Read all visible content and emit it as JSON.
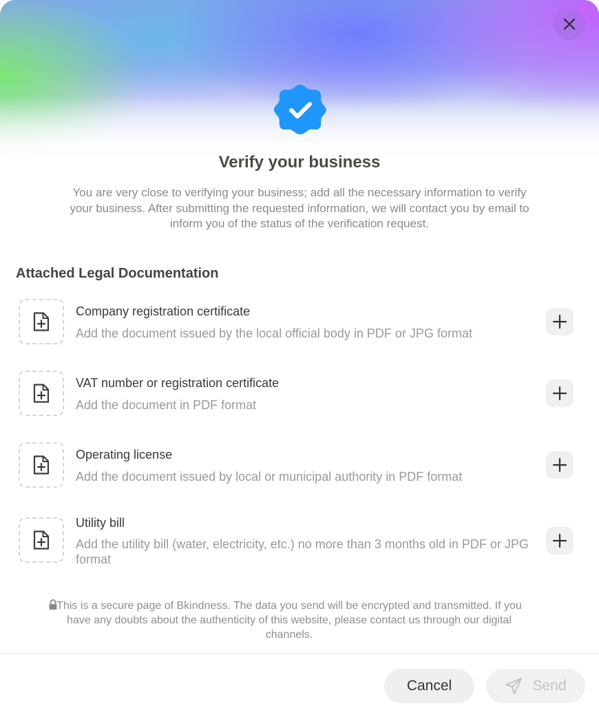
{
  "modal": {
    "title": "Verify your business",
    "description": "You are very close to verifying your business; add all the necessary information to verify your business. After submitting the requested information, we will contact you by email to inform you of the status of the verification request.",
    "close_icon": "close-icon",
    "badge_icon": "verified-badge-icon",
    "badge_color": "#1e96fa"
  },
  "documents": {
    "section_title": "Attached Legal Documentation",
    "items": [
      {
        "title": "Company registration certificate",
        "description": "Add the document issued by the local official body in PDF or JPG format",
        "icon": "file-plus-icon",
        "action_icon": "plus-icon"
      },
      {
        "title": "VAT number or registration certificate",
        "description": "Add the document in PDF format",
        "icon": "file-plus-icon",
        "action_icon": "plus-icon"
      },
      {
        "title": "Operating license",
        "description": "Add the document issued by local or municipal authority in PDF format",
        "icon": "file-plus-icon",
        "action_icon": "plus-icon"
      },
      {
        "title": "Utility bill",
        "description": "Add the utility bill (water, electricity, etc.) no more than 3 months old in PDF or JPG format",
        "icon": "file-plus-icon",
        "action_icon": "plus-icon"
      }
    ]
  },
  "secure_note": {
    "icon": "lock-icon",
    "text": "This is a secure page of Bkindness. The data you send will be encrypted and transmitted. If you have any doubts about the authenticity of this website, please contact us through our digital channels."
  },
  "footer": {
    "cancel_label": "Cancel",
    "send_label": "Send",
    "send_icon": "send-icon"
  }
}
